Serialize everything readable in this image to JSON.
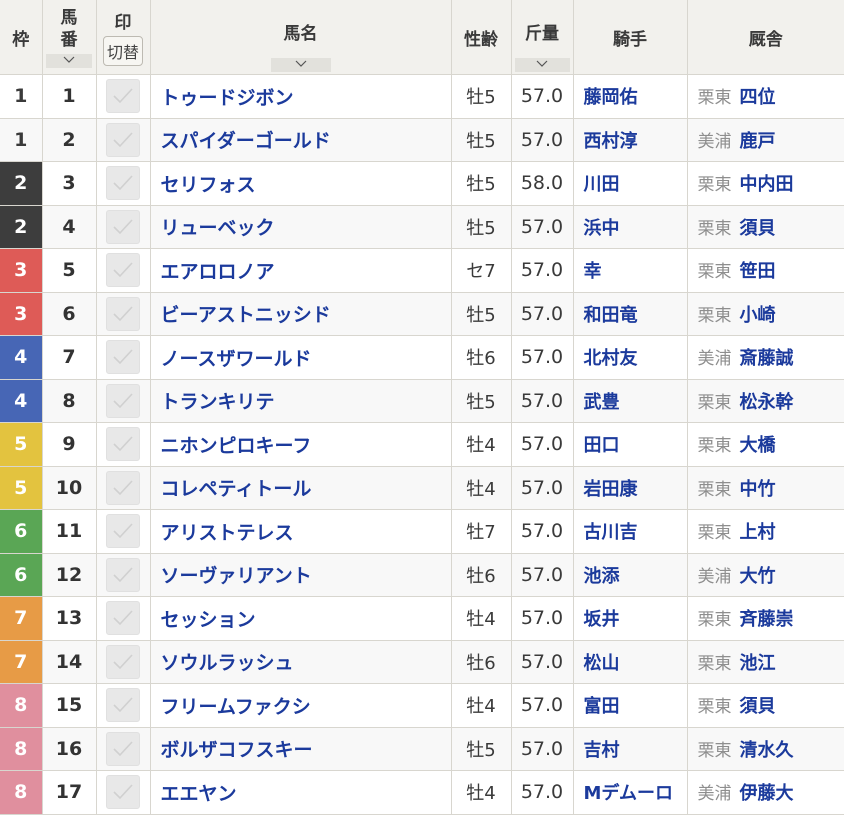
{
  "headers": {
    "waku": "枠",
    "umaban_top": "馬",
    "umaban_bottom": "番",
    "mark": "印",
    "mark_toggle": "切替",
    "name": "馬名",
    "sexage": "性齢",
    "weight": "斤量",
    "jockey": "騎手",
    "trainer": "厩舎"
  },
  "waku_colors": {
    "1": {
      "bg": "#ffffff",
      "fg": "#333333"
    },
    "2": {
      "bg": "#3d3d3d",
      "fg": "#ffffff"
    },
    "3": {
      "bg": "#de5b57",
      "fg": "#ffffff"
    },
    "4": {
      "bg": "#4766b5",
      "fg": "#ffffff"
    },
    "5": {
      "bg": "#e3c33f",
      "fg": "#ffffff"
    },
    "6": {
      "bg": "#5aa655",
      "fg": "#ffffff"
    },
    "7": {
      "bg": "#e79b46",
      "fg": "#ffffff"
    },
    "8": {
      "bg": "#e08f9e",
      "fg": "#ffffff"
    }
  },
  "rows": [
    {
      "waku": "1",
      "umaban": "1",
      "name": "トゥードジボン",
      "sexage": "牡5",
      "weight": "57.0",
      "jockey": "藤岡佑",
      "affiliation": "栗東",
      "trainer": "四位",
      "checked": false
    },
    {
      "waku": "1",
      "umaban": "2",
      "name": "スパイダーゴールド",
      "sexage": "牡5",
      "weight": "57.0",
      "jockey": "西村淳",
      "affiliation": "美浦",
      "trainer": "鹿戸",
      "checked": false
    },
    {
      "waku": "2",
      "umaban": "3",
      "name": "セリフォス",
      "sexage": "牡5",
      "weight": "58.0",
      "jockey": "川田",
      "affiliation": "栗東",
      "trainer": "中内田",
      "checked": false
    },
    {
      "waku": "2",
      "umaban": "4",
      "name": "リューベック",
      "sexage": "牡5",
      "weight": "57.0",
      "jockey": "浜中",
      "affiliation": "栗東",
      "trainer": "須貝",
      "checked": false
    },
    {
      "waku": "3",
      "umaban": "5",
      "name": "エアロロノア",
      "sexage": "セ7",
      "weight": "57.0",
      "jockey": "幸",
      "affiliation": "栗東",
      "trainer": "笹田",
      "checked": false
    },
    {
      "waku": "3",
      "umaban": "6",
      "name": "ビーアストニッシド",
      "sexage": "牡5",
      "weight": "57.0",
      "jockey": "和田竜",
      "affiliation": "栗東",
      "trainer": "小崎",
      "checked": false
    },
    {
      "waku": "4",
      "umaban": "7",
      "name": "ノースザワールド",
      "sexage": "牡6",
      "weight": "57.0",
      "jockey": "北村友",
      "affiliation": "美浦",
      "trainer": "斎藤誠",
      "checked": false
    },
    {
      "waku": "4",
      "umaban": "8",
      "name": "トランキリテ",
      "sexage": "牡5",
      "weight": "57.0",
      "jockey": "武豊",
      "affiliation": "栗東",
      "trainer": "松永幹",
      "checked": false
    },
    {
      "waku": "5",
      "umaban": "9",
      "name": "ニホンピロキーフ",
      "sexage": "牡4",
      "weight": "57.0",
      "jockey": "田口",
      "affiliation": "栗東",
      "trainer": "大橋",
      "checked": false
    },
    {
      "waku": "5",
      "umaban": "10",
      "name": "コレペティトール",
      "sexage": "牡4",
      "weight": "57.0",
      "jockey": "岩田康",
      "affiliation": "栗東",
      "trainer": "中竹",
      "checked": false
    },
    {
      "waku": "6",
      "umaban": "11",
      "name": "アリストテレス",
      "sexage": "牡7",
      "weight": "57.0",
      "jockey": "古川吉",
      "affiliation": "栗東",
      "trainer": "上村",
      "checked": false
    },
    {
      "waku": "6",
      "umaban": "12",
      "name": "ソーヴァリアント",
      "sexage": "牡6",
      "weight": "57.0",
      "jockey": "池添",
      "affiliation": "美浦",
      "trainer": "大竹",
      "checked": false
    },
    {
      "waku": "7",
      "umaban": "13",
      "name": "セッション",
      "sexage": "牡4",
      "weight": "57.0",
      "jockey": "坂井",
      "affiliation": "栗東",
      "trainer": "斉藤崇",
      "checked": false
    },
    {
      "waku": "7",
      "umaban": "14",
      "name": "ソウルラッシュ",
      "sexage": "牡6",
      "weight": "57.0",
      "jockey": "松山",
      "affiliation": "栗東",
      "trainer": "池江",
      "checked": false
    },
    {
      "waku": "8",
      "umaban": "15",
      "name": "フリームファクシ",
      "sexage": "牡4",
      "weight": "57.0",
      "jockey": "富田",
      "affiliation": "栗東",
      "trainer": "須貝",
      "checked": false
    },
    {
      "waku": "8",
      "umaban": "16",
      "name": "ボルザコフスキー",
      "sexage": "牡5",
      "weight": "57.0",
      "jockey": "吉村",
      "affiliation": "栗東",
      "trainer": "清水久",
      "checked": false
    },
    {
      "waku": "8",
      "umaban": "17",
      "name": "エエヤン",
      "sexage": "牡4",
      "weight": "57.0",
      "jockey": "Mデムーロ",
      "affiliation": "美浦",
      "trainer": "伊藤大",
      "checked": false
    }
  ]
}
